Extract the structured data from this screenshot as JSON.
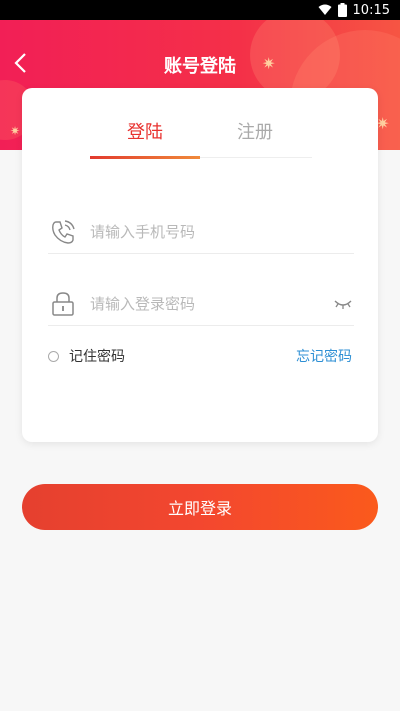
{
  "status_bar": {
    "time": "10:15"
  },
  "header": {
    "title": "账号登陆"
  },
  "tabs": [
    {
      "label": "登陆",
      "active": true
    },
    {
      "label": "注册",
      "active": false
    }
  ],
  "form": {
    "phone": {
      "value": "",
      "placeholder": "请输入手机号码"
    },
    "password": {
      "value": "",
      "placeholder": "请输入登录密码"
    },
    "remember_label": "记住密码",
    "remember_checked": false,
    "forgot_label": "忘记密码"
  },
  "login_button": "立即登录",
  "colors": {
    "brand_red": "#f21f56",
    "accent": "#e8322f",
    "link": "#2d8fd4"
  }
}
